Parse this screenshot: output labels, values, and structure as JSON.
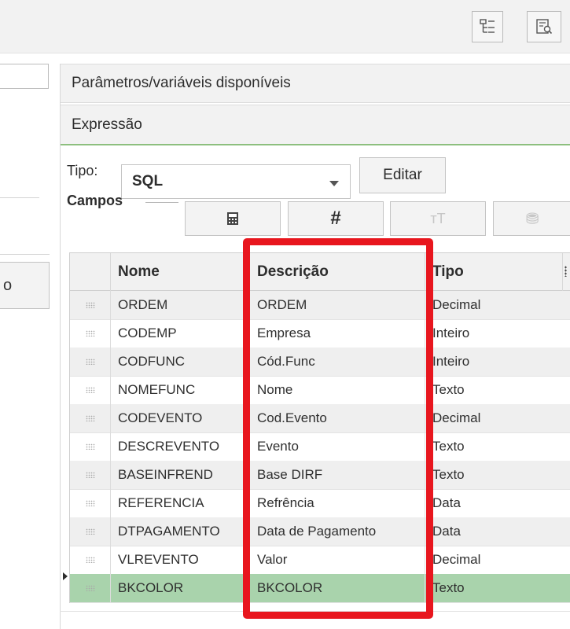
{
  "toolbar": {
    "icons": [
      "tree-structure-icon",
      "search-document-icon"
    ]
  },
  "left_panel": {
    "button_label": "o"
  },
  "panel": {
    "params_header": "Parâmetros/variáveis disponíveis",
    "expr_header": "Expressão",
    "tipo_label": "Tipo:",
    "tipo_value": "SQL",
    "editar_label": "Editar",
    "campos_label": "Campos",
    "campos_buttons": [
      {
        "icon": "calculator-icon",
        "glyph": "🖩",
        "enabled": true
      },
      {
        "icon": "hash-icon",
        "glyph": "#",
        "enabled": true
      },
      {
        "icon": "text-size-icon",
        "glyph": "тT",
        "enabled": false
      },
      {
        "icon": "coins-icon",
        "glyph": "⛃",
        "enabled": false
      }
    ]
  },
  "grid": {
    "columns": [
      "Nome",
      "Descrição",
      "Tipo"
    ],
    "rows": [
      {
        "nome": "ORDEM",
        "descricao": "ORDEM",
        "tipo": "Decimal"
      },
      {
        "nome": "CODEMP",
        "descricao": "Empresa",
        "tipo": "Inteiro"
      },
      {
        "nome": "CODFUNC",
        "descricao": "Cód.Func",
        "tipo": "Inteiro"
      },
      {
        "nome": "NOMEFUNC",
        "descricao": "Nome",
        "tipo": "Texto"
      },
      {
        "nome": "CODEVENTO",
        "descricao": "Cod.Evento",
        "tipo": "Decimal"
      },
      {
        "nome": "DESCREVENTO",
        "descricao": "Evento",
        "tipo": "Texto"
      },
      {
        "nome": "BASEINFREND",
        "descricao": "Base DIRF",
        "tipo": "Texto"
      },
      {
        "nome": "REFERENCIA",
        "descricao": "Refrência",
        "tipo": "Data"
      },
      {
        "nome": "DTPAGAMENTO",
        "descricao": "Data de Pagamento",
        "tipo": "Data"
      },
      {
        "nome": "VLREVENTO",
        "descricao": "Valor",
        "tipo": "Decimal"
      },
      {
        "nome": "BKCOLOR",
        "descricao": "BKCOLOR",
        "tipo": "Texto"
      }
    ],
    "selected_row": 10
  },
  "colors": {
    "highlight": "#e8161e",
    "selected_row": "#a9d3ac",
    "expr_underline": "#8dbf7e"
  }
}
